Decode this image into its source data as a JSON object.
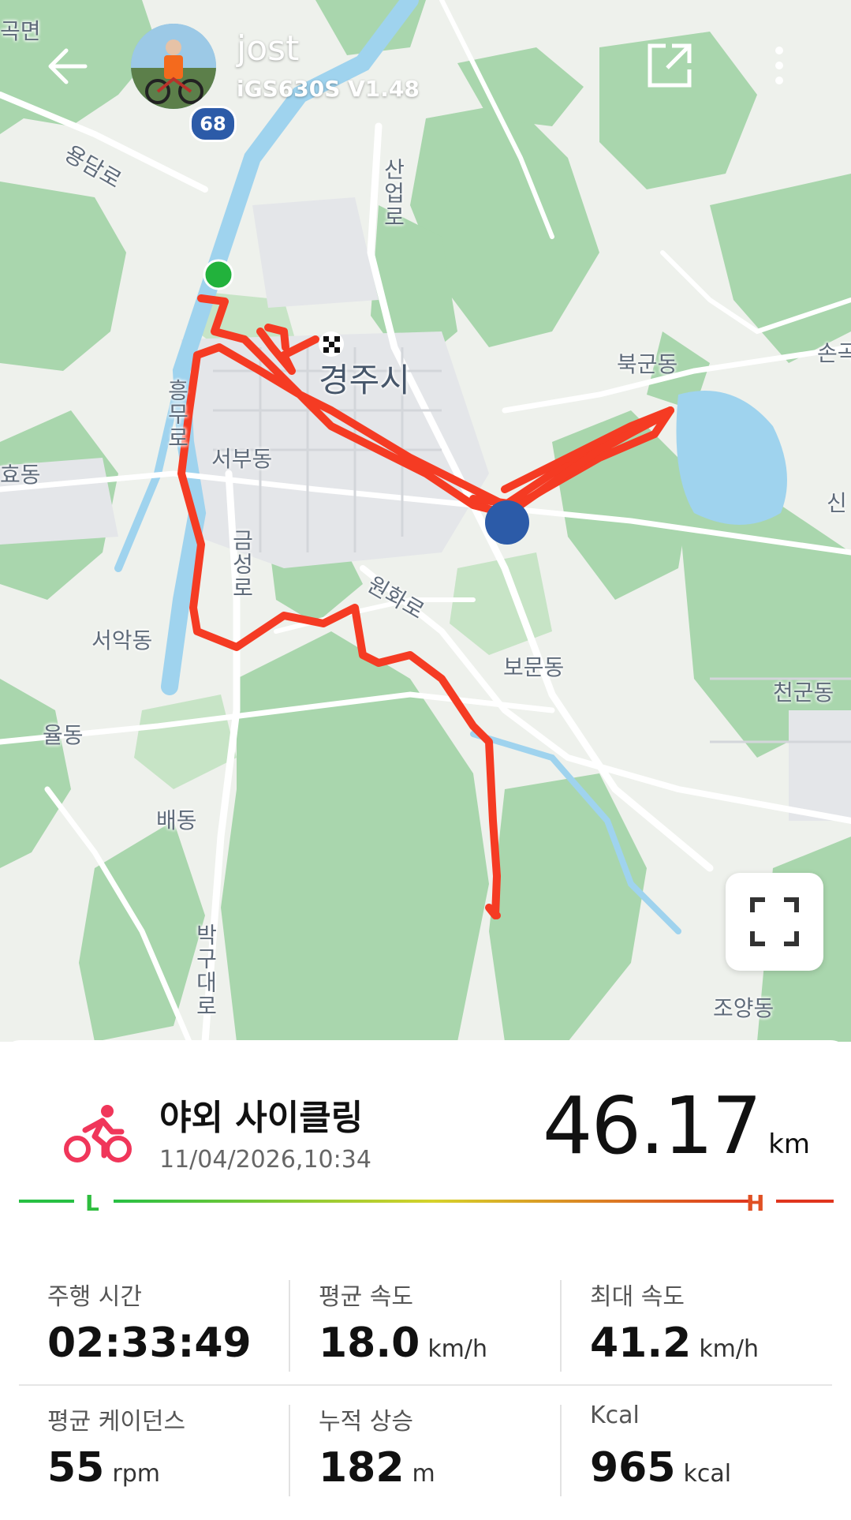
{
  "header": {
    "user_name": "jost",
    "device": "iGS630S  V1.48"
  },
  "map": {
    "route_shield": "68",
    "labels": [
      "경주시",
      "북군동",
      "서부동",
      "보문동",
      "서악동",
      "천군동",
      "율동",
      "배동",
      "조양동",
      "효동",
      "손곡",
      "신"
    ],
    "road_labels": [
      "용담로",
      "산업로",
      "흥무로",
      "금성로",
      "원화로",
      "박구대로"
    ],
    "corner_label": "곡면",
    "route_color": "#f53b23",
    "start_color": "#22b23c"
  },
  "activity": {
    "type": "야외 사이클링",
    "datetime": "11/04/2026,10:34",
    "distance": "46.17",
    "distance_unit": "km",
    "icon_color": "#f0365a"
  },
  "scale": {
    "low": "L",
    "high": "H"
  },
  "stats": [
    {
      "label": "주행 시간",
      "value": "02:33:49",
      "unit": ""
    },
    {
      "label": "평균 속도",
      "value": "18.0",
      "unit": "km/h"
    },
    {
      "label": "최대 속도",
      "value": "41.2",
      "unit": "km/h"
    },
    {
      "label": "평균 케이던스",
      "value": "55",
      "unit": "rpm"
    },
    {
      "label": "누적 상승",
      "value": "182",
      "unit": "m"
    },
    {
      "label": "Kcal",
      "value": "965",
      "unit": "kcal"
    }
  ]
}
